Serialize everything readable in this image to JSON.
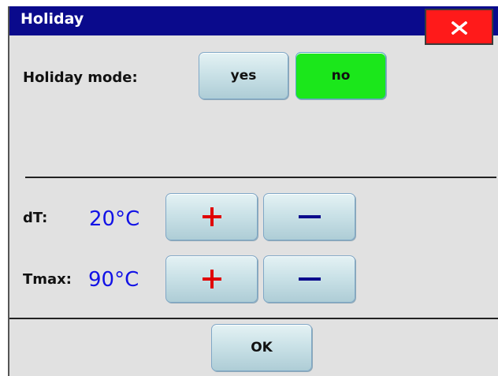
{
  "window": {
    "title": "Holiday",
    "close_label": "X"
  },
  "holiday_mode": {
    "label": "Holiday mode:",
    "yes_label": "yes",
    "no_label": "no",
    "selected": "no"
  },
  "dt": {
    "label": "dT:",
    "value": "20°C"
  },
  "tmax": {
    "label": "Tmax:",
    "value": "90°C"
  },
  "footer": {
    "ok_label": "OK"
  },
  "colors": {
    "titlebar": "#0a0a8c",
    "close_button": "#ff1a1a",
    "active_button": "#1be71b",
    "value_text": "#1212e6",
    "plus_icon": "#e00000",
    "minus_icon": "#0a0a8c",
    "background": "#e1e1e1"
  },
  "icons": {
    "close": "close-icon",
    "increase": "plus-icon",
    "decrease": "minus-icon"
  }
}
